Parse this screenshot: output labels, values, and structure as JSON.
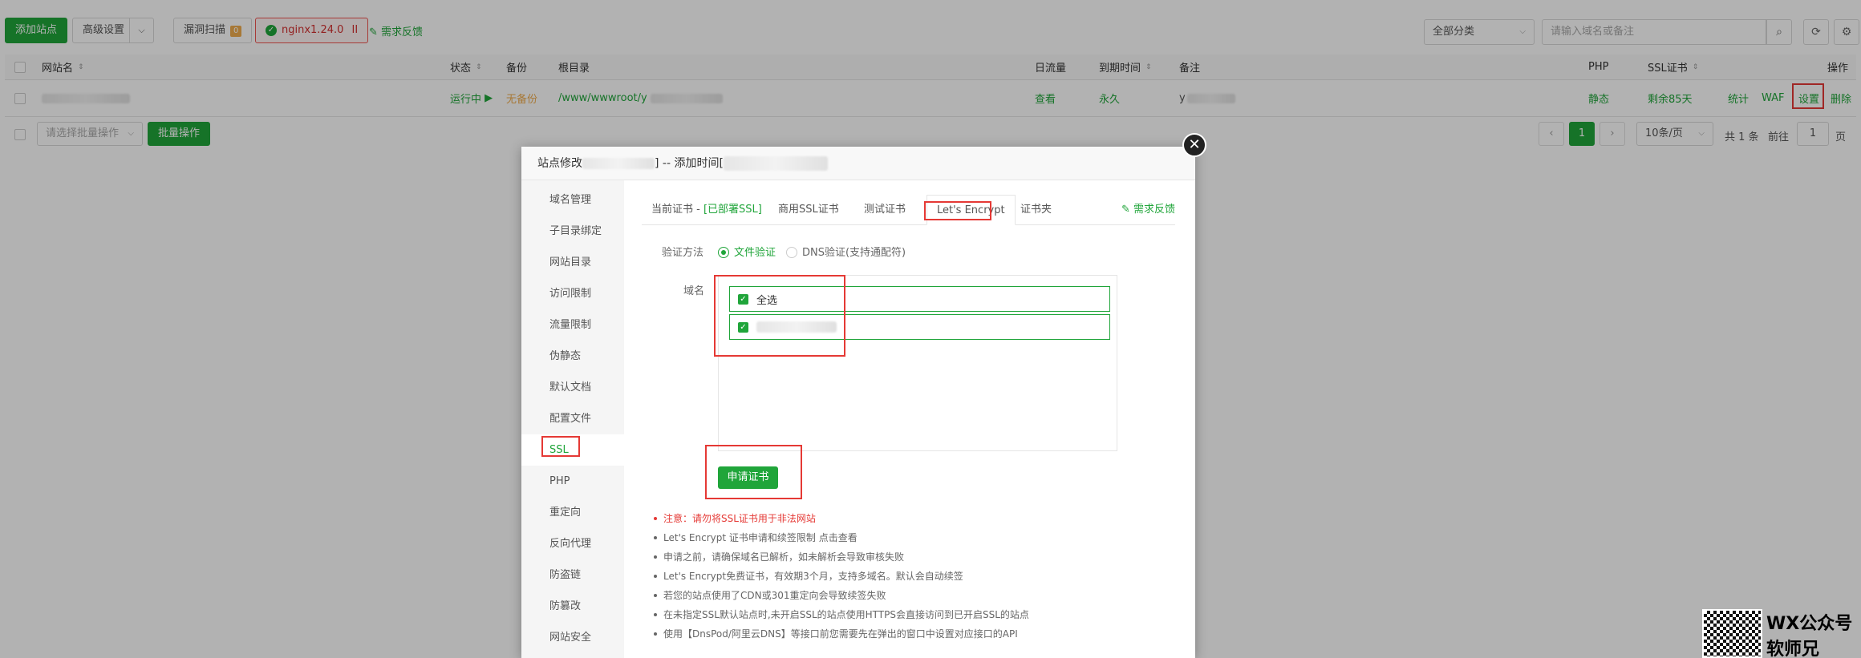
{
  "toolbar": {
    "add_site": "添加站点",
    "advanced": "高级设置",
    "vuln_scan": "漏洞扫描",
    "vuln_count": "0",
    "nginx": "nginx1.24.0",
    "nginx_pause": "II",
    "feedback": "需求反馈",
    "category_select": "全部分类",
    "search_placeholder": "请输入域名或备注"
  },
  "table": {
    "headers": {
      "site_name": "网站名",
      "status": "状态",
      "backup": "备份",
      "root_dir": "根目录",
      "traffic": "日流量",
      "expire": "到期时间",
      "note": "备注",
      "php": "PHP",
      "ssl": "SSL证书",
      "actions": "操作"
    },
    "row": {
      "status": "运行中",
      "status_icon": "▶",
      "backup": "无备份",
      "root_dir": "/www/wwwroot/y",
      "traffic": "查看",
      "expire": "永久",
      "note": "y",
      "php": "静态",
      "ssl": "剩余85天",
      "stats": "统计",
      "waf": "WAF",
      "settings": "设置",
      "delete": "删除"
    }
  },
  "footer": {
    "batch_placeholder": "请选择批量操作",
    "batch_btn": "批量操作",
    "page": "1",
    "per_page": "10条/页",
    "total": "共 1 条",
    "goto_label": "前往",
    "goto_value": "1",
    "page_suffix": "页"
  },
  "modal": {
    "title_prefix": "站点修改",
    "title_middle": "] -- 添加时间[",
    "menu": [
      "域名管理",
      "子目录绑定",
      "网站目录",
      "访问限制",
      "流量限制",
      "伪静态",
      "默认文档",
      "配置文件",
      "SSL",
      "PHP",
      "重定向",
      "反向代理",
      "防盗链",
      "防篡改",
      "网站安全"
    ],
    "tabs": {
      "current_prefix": "当前证书 - ",
      "current_status": "[已部署SSL]",
      "commercial": "商用SSL证书",
      "test": "测试证书",
      "letsencrypt": "Let's Encrypt",
      "cert_folder": "证书夹",
      "feedback": "需求反馈"
    },
    "verify_label": "验证方法",
    "verify_file": "文件验证",
    "verify_dns": "DNS验证(支持通配符)",
    "domain_label": "域名",
    "select_all": "全选",
    "apply_btn": "申请证书",
    "notes": [
      "注意：请勿将SSL证书用于非法网站",
      "Let's Encrypt 证书申请和续签限制 点击查看",
      "申请之前，请确保域名已解析，如未解析会导致审核失败",
      "Let's Encrypt免费证书，有效期3个月，支持多域名。默认会自动续签",
      "若您的站点使用了CDN或301重定向会导致续签失败",
      "在未指定SSL默认站点时,未开启SSL的站点使用HTTPS会直接访问到已开启SSL的站点",
      "使用【DnsPod/阿里云DNS】等接口前您需要先在弹出的窗口中设置对应接口的API"
    ]
  },
  "watermark": {
    "line1": "WX公众号",
    "line2": "软师兄"
  }
}
